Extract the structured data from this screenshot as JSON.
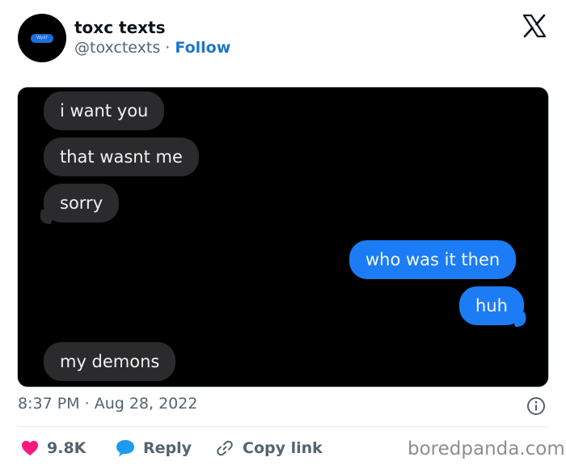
{
  "author": {
    "name": "toxc texts",
    "handle": "@toxctexts",
    "separator": "·",
    "follow_label": "Follow",
    "avatar_text": "Wyd?"
  },
  "platform": {
    "icon": "x-logo-icon"
  },
  "media": {
    "messages": [
      {
        "side": "received",
        "text": "i want you"
      },
      {
        "side": "received",
        "text": "that wasnt me"
      },
      {
        "side": "received",
        "text": "sorry"
      },
      {
        "side": "sent",
        "text": "who was it then"
      },
      {
        "side": "sent",
        "text": "huh"
      },
      {
        "side": "received",
        "text": "my demons"
      }
    ]
  },
  "post": {
    "time": "8:37 PM",
    "separator": "·",
    "date": "Aug 28, 2022"
  },
  "actions": {
    "like_count": "9.8K",
    "reply_label": "Reply",
    "copy_link_label": "Copy link"
  },
  "watermark": "boredpanda.com",
  "colors": {
    "follow": "#1d77c9",
    "like": "#f91880",
    "reply": "#1d9bf0",
    "sent_bubble": "#1c7cf5",
    "received_bubble": "#2b2b2d"
  }
}
